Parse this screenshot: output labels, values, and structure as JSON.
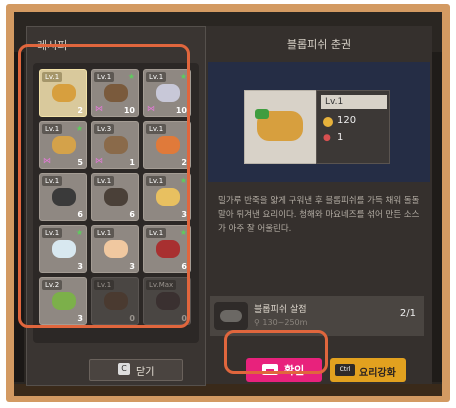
{
  "left_panel": {
    "title": "레시피"
  },
  "recipes": [
    {
      "level": "Lv.1",
      "count": "2",
      "star": false,
      "bow": false,
      "selected": true,
      "locked": false,
      "color": "#d79f3e"
    },
    {
      "level": "Lv.1",
      "count": "10",
      "star": true,
      "bow": true,
      "selected": false,
      "locked": false,
      "color": "#7a5a3c"
    },
    {
      "level": "Lv.1",
      "count": "10",
      "star": true,
      "bow": true,
      "selected": false,
      "locked": false,
      "color": "#c8c8d8"
    },
    {
      "level": "Lv.1",
      "count": "5",
      "star": true,
      "bow": true,
      "selected": false,
      "locked": false,
      "color": "#d4a24a"
    },
    {
      "level": "Lv.3",
      "count": "1",
      "star": false,
      "bow": true,
      "selected": false,
      "locked": false,
      "color": "#8a6a4a"
    },
    {
      "level": "Lv.1",
      "count": "2",
      "star": false,
      "bow": false,
      "selected": false,
      "locked": false,
      "color": "#e07a3a"
    },
    {
      "level": "Lv.1",
      "count": "6",
      "star": false,
      "bow": false,
      "selected": false,
      "locked": false,
      "color": "#3a3a3a"
    },
    {
      "level": "Lv.1",
      "count": "6",
      "star": false,
      "bow": false,
      "selected": false,
      "locked": false,
      "color": "#4a4038"
    },
    {
      "level": "Lv.1",
      "count": "3",
      "star": true,
      "bow": false,
      "selected": false,
      "locked": false,
      "color": "#e8c060"
    },
    {
      "level": "Lv.1",
      "count": "3",
      "star": true,
      "bow": false,
      "selected": false,
      "locked": false,
      "color": "#d8e8f0"
    },
    {
      "level": "Lv.1",
      "count": "3",
      "star": false,
      "bow": false,
      "selected": false,
      "locked": false,
      "color": "#f0c8a0"
    },
    {
      "level": "Lv.1",
      "count": "6",
      "star": true,
      "bow": false,
      "selected": false,
      "locked": false,
      "color": "#a83030"
    },
    {
      "level": "Lv.2",
      "count": "3",
      "star": false,
      "bow": false,
      "selected": false,
      "locked": false,
      "color": "#7cb04a"
    },
    {
      "level": "Lv.1",
      "count": "0",
      "star": false,
      "bow": false,
      "selected": false,
      "locked": true,
      "color": "#4a3a30"
    },
    {
      "level": "Lv.Max",
      "count": "0",
      "star": false,
      "bow": false,
      "selected": false,
      "locked": true,
      "color": "#3a3030"
    }
  ],
  "close_button": {
    "key": "C",
    "label": "닫기"
  },
  "detail": {
    "title": "블롭피쉬 춘권",
    "level": "Lv.1",
    "price": "120",
    "stamina": "1",
    "description": "밀가루 반죽을 얇게 구워낸 후 블롭피쉬를 가득 채워 돌돌 말아 튀겨낸 요리이다. 청해와 마요네즈를 섞어 만든 소스가 아주 잘 어울린다.",
    "ingredient": {
      "name": "블롭피쉬 살점",
      "location": "130~250m",
      "count": "2/1"
    }
  },
  "confirm_button": {
    "label": "확인"
  },
  "enhance_button": {
    "key": "Ctrl",
    "label": "요리강화"
  },
  "colors": {
    "accent_highlight": "#e0663d",
    "confirm": "#e8227c",
    "enhance": "#e2a11f"
  }
}
